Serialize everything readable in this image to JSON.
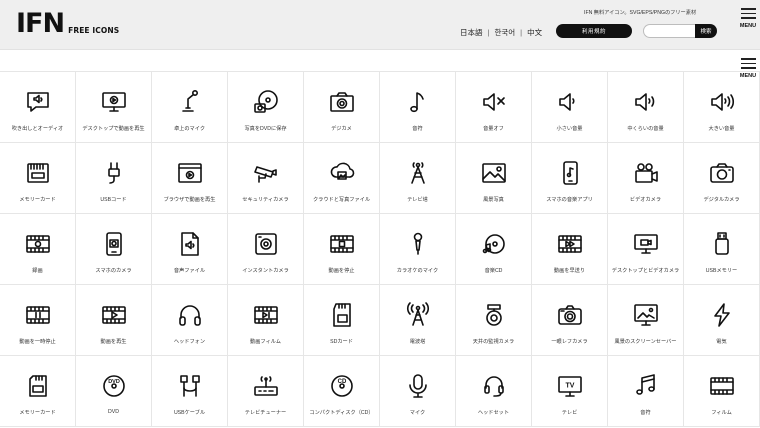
{
  "header": {
    "logo": "IFN",
    "logo_sub": "FREE ICONS",
    "tagline": "IFN 無料アイコン。SVG/EPS/PNGのフリー素材",
    "languages": [
      "日本語",
      "한국어",
      "中文"
    ],
    "terms_label": "利用規約",
    "search_placeholder": "",
    "search_button": "検索",
    "menu_label": "MENU"
  },
  "side_menu_label": "MENU",
  "icons": [
    {
      "label": "吹き出しとオーディオ",
      "icon": "speech-bubble-audio-icon"
    },
    {
      "label": "デスクトップで動画を再生",
      "icon": "desktop-video-icon"
    },
    {
      "label": "卓上のマイク",
      "icon": "desk-microphone-icon"
    },
    {
      "label": "写真をDVDに保存",
      "icon": "photo-dvd-icon"
    },
    {
      "label": "デジカメ",
      "icon": "digital-camera-icon"
    },
    {
      "label": "音符",
      "icon": "music-note-icon"
    },
    {
      "label": "音量オフ",
      "icon": "volume-off-icon"
    },
    {
      "label": "小さい音量",
      "icon": "volume-low-icon"
    },
    {
      "label": "中くらいの音量",
      "icon": "volume-medium-icon"
    },
    {
      "label": "大きい音量",
      "icon": "volume-high-icon"
    },
    {
      "label": "メモリーカード",
      "icon": "memory-card-icon"
    },
    {
      "label": "USBコード",
      "icon": "usb-cord-icon"
    },
    {
      "label": "ブラウザで動画を再生",
      "icon": "browser-video-icon"
    },
    {
      "label": "セキュリティカメラ",
      "icon": "security-camera-icon"
    },
    {
      "label": "クラウドと写真ファイル",
      "icon": "cloud-photo-icon"
    },
    {
      "label": "テレビ塔",
      "icon": "tv-tower-icon"
    },
    {
      "label": "風景写真",
      "icon": "landscape-photo-icon"
    },
    {
      "label": "スマホの音楽アプリ",
      "icon": "phone-music-icon"
    },
    {
      "label": "ビデオカメラ",
      "icon": "video-camera-icon"
    },
    {
      "label": "デジタルカメラ",
      "icon": "digital-camera-2-icon"
    },
    {
      "label": "録画",
      "icon": "recording-icon"
    },
    {
      "label": "スマホのカメラ",
      "icon": "phone-camera-icon"
    },
    {
      "label": "音声ファイル",
      "icon": "audio-file-icon"
    },
    {
      "label": "インスタントカメラ",
      "icon": "instant-camera-icon"
    },
    {
      "label": "動画を停止",
      "icon": "video-stop-icon"
    },
    {
      "label": "カラオケのマイク",
      "icon": "karaoke-mic-icon"
    },
    {
      "label": "音楽CD",
      "icon": "music-cd-icon"
    },
    {
      "label": "動画を早送り",
      "icon": "video-fast-forward-icon"
    },
    {
      "label": "デスクトップとビデオカメラ",
      "icon": "desktop-video-camera-icon"
    },
    {
      "label": "USBメモリー",
      "icon": "usb-memory-icon"
    },
    {
      "label": "動画を一時停止",
      "icon": "video-pause-icon"
    },
    {
      "label": "動画を再生",
      "icon": "video-play-icon"
    },
    {
      "label": "ヘッドフォン",
      "icon": "headphones-icon"
    },
    {
      "label": "動画フィルム",
      "icon": "video-film-icon"
    },
    {
      "label": "SDカード",
      "icon": "sd-card-icon"
    },
    {
      "label": "電波塔",
      "icon": "radio-tower-icon"
    },
    {
      "label": "天井の監視カメラ",
      "icon": "ceiling-camera-icon"
    },
    {
      "label": "一眼レフカメラ",
      "icon": "slr-camera-icon"
    },
    {
      "label": "風景のスクリーンセーバー",
      "icon": "landscape-screensaver-icon"
    },
    {
      "label": "電気",
      "icon": "electricity-icon"
    },
    {
      "label": "メモリーカード",
      "icon": "memory-card-2-icon"
    },
    {
      "label": "DVD",
      "icon": "dvd-icon"
    },
    {
      "label": "USBケーブル",
      "icon": "usb-cable-icon"
    },
    {
      "label": "テレビチューナー",
      "icon": "tv-tuner-icon"
    },
    {
      "label": "コンパクトディスク（CD）",
      "icon": "compact-disc-icon"
    },
    {
      "label": "マイク",
      "icon": "microphone-icon"
    },
    {
      "label": "ヘッドセット",
      "icon": "headset-icon"
    },
    {
      "label": "テレビ",
      "icon": "tv-icon"
    },
    {
      "label": "音符",
      "icon": "music-notes-icon"
    },
    {
      "label": "フィルム",
      "icon": "film-icon"
    }
  ],
  "glyph_text": {
    "tv": "TV",
    "dvd": "DVD",
    "cd": "CD"
  }
}
